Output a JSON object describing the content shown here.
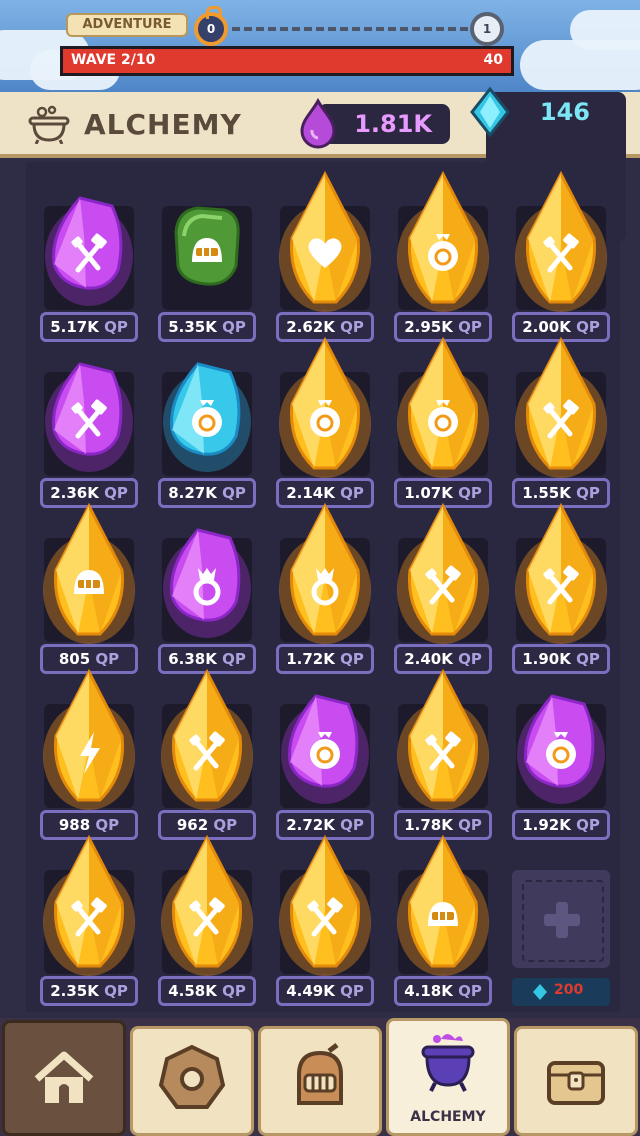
{
  "top_bar": {
    "adventure_label": "ADVENTURE",
    "progress_start": "0",
    "progress_end": "1",
    "wave_label": "WAVE 2/10",
    "wave_value": "40",
    "wave_fill": 1.0
  },
  "header": {
    "title": "ALCHEMY",
    "qp_value": "1.81K",
    "gem_value": "146",
    "qp_color": "#b64ad9",
    "gem_color": "#35c6e3"
  },
  "grid": {
    "unit": "QP",
    "rows": [
      [
        {
          "value": "5.17K",
          "color": "purple",
          "icon": "hammer-icon"
        },
        {
          "value": "5.35K",
          "color": "green",
          "icon": "helmet-icon"
        },
        {
          "value": "2.62K",
          "color": "gold",
          "icon": "heart-icon"
        },
        {
          "value": "2.95K",
          "color": "gold",
          "icon": "money-bag-icon"
        },
        {
          "value": "2.00K",
          "color": "gold",
          "icon": "hammer-icon"
        }
      ],
      [
        {
          "value": "2.36K",
          "color": "purple",
          "icon": "hammer-icon"
        },
        {
          "value": "8.27K",
          "color": "blue",
          "icon": "money-bag-icon"
        },
        {
          "value": "2.14K",
          "color": "gold",
          "icon": "money-bag-icon"
        },
        {
          "value": "1.07K",
          "color": "gold",
          "icon": "money-bag-icon"
        },
        {
          "value": "1.55K",
          "color": "gold",
          "icon": "hammer-icon"
        }
      ],
      [
        {
          "value": "805",
          "color": "gold",
          "icon": "helmet-icon"
        },
        {
          "value": "6.38K",
          "color": "purple",
          "icon": "ring-icon"
        },
        {
          "value": "1.72K",
          "color": "gold",
          "icon": "ring-icon"
        },
        {
          "value": "2.40K",
          "color": "gold",
          "icon": "hammer-icon"
        },
        {
          "value": "1.90K",
          "color": "gold",
          "icon": "hammer-icon"
        }
      ],
      [
        {
          "value": "988",
          "color": "gold",
          "icon": "lightning-icon"
        },
        {
          "value": "962",
          "color": "gold",
          "icon": "hammer-icon"
        },
        {
          "value": "2.72K",
          "color": "purple",
          "icon": "money-bag-icon"
        },
        {
          "value": "1.78K",
          "color": "gold",
          "icon": "hammer-icon"
        },
        {
          "value": "1.92K",
          "color": "purple",
          "icon": "money-bag-icon"
        }
      ],
      [
        {
          "value": "2.35K",
          "color": "gold",
          "icon": "hammer-icon"
        },
        {
          "value": "4.58K",
          "color": "gold",
          "icon": "hammer-icon"
        },
        {
          "value": "4.49K",
          "color": "gold",
          "icon": "hammer-icon"
        },
        {
          "value": "4.18K",
          "color": "gold",
          "icon": "helmet-icon"
        },
        {
          "empty": true,
          "cost": "200",
          "icon": "plus-icon"
        }
      ]
    ]
  },
  "nav": {
    "tabs": [
      {
        "name": "home",
        "icon": "house-icon"
      },
      {
        "name": "upgrades",
        "icon": "gear-icon"
      },
      {
        "name": "heroes",
        "icon": "knight-helmet-icon"
      },
      {
        "name": "alchemy",
        "label": "ALCHEMY",
        "icon": "cauldron-icon",
        "active": true
      },
      {
        "name": "treasure",
        "icon": "chest-icon"
      }
    ]
  }
}
